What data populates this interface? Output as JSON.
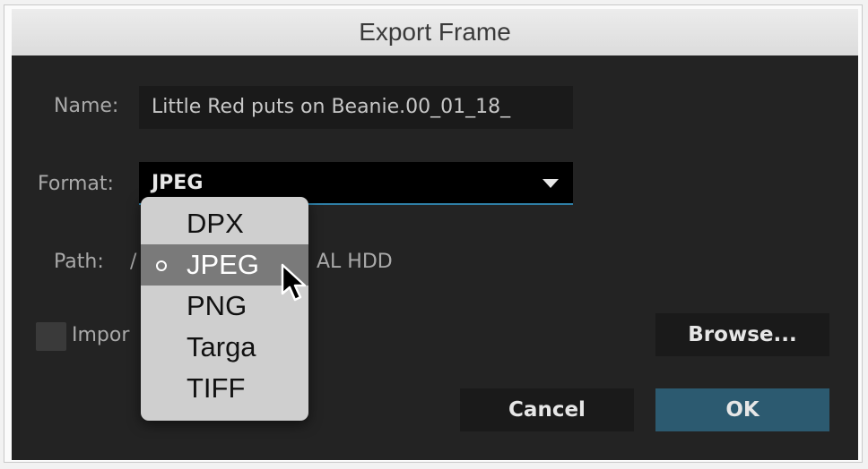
{
  "window": {
    "title": "Export Frame"
  },
  "form": {
    "name_label": "Name:",
    "name_value": "Little Red puts on Beanie.00_01_18_",
    "format_label": "Format:",
    "format_value": "JPEG",
    "path_label": "Path:",
    "path_value_start": "/",
    "path_value_end": "AL HDD",
    "import_label": "Impor"
  },
  "buttons": {
    "browse": "Browse...",
    "cancel": "Cancel",
    "ok": "OK"
  },
  "format_menu": {
    "items": [
      {
        "label": "DPX",
        "selected": false
      },
      {
        "label": "JPEG",
        "selected": true
      },
      {
        "label": "PNG",
        "selected": false
      },
      {
        "label": "Targa",
        "selected": false
      },
      {
        "label": "TIFF",
        "selected": false
      }
    ]
  },
  "colors": {
    "accent": "#2c5a70",
    "select_underline": "#2f7fa6",
    "background": "#232323"
  }
}
